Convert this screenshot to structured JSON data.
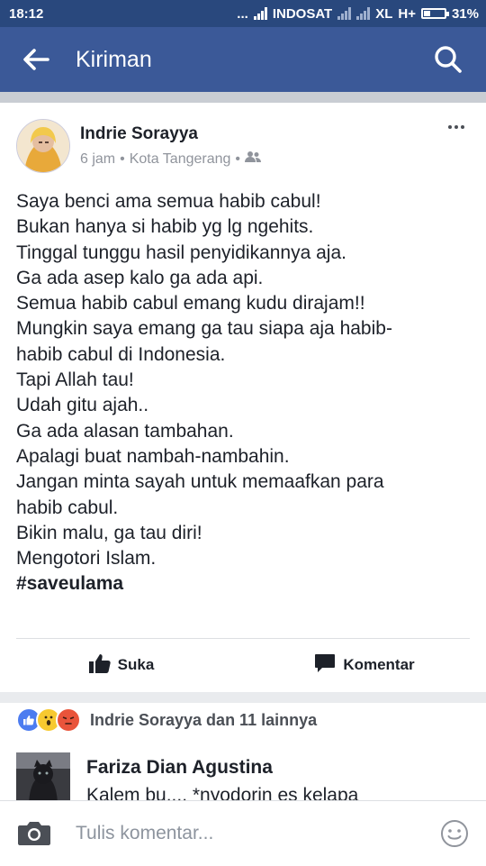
{
  "status_bar": {
    "time": "18:12",
    "dots": "...",
    "carrier1": "INDOSAT",
    "carrier2": "XL",
    "network": "H+",
    "battery_text": "31%",
    "battery_level": 0.31
  },
  "app_bar": {
    "title": "Kiriman",
    "back_icon": "arrow-left-icon",
    "search_icon": "search-icon"
  },
  "post": {
    "author": "Indrie Sorayya",
    "time": "6 jam",
    "sep1": "•",
    "location": "Kota Tangerang",
    "sep2": "•",
    "privacy_icon": "friends-icon",
    "more_icon": "more-dots-icon",
    "lines": [
      "Saya benci ama semua habib cabul!",
      "Bukan hanya si habib yg lg ngehits.",
      "Tinggal tunggu hasil penyidikannya aja.",
      "Ga ada asep kalo ga ada api.",
      "Semua habib cabul emang kudu dirajam!!",
      "Mungkin saya emang ga tau siapa aja habib-",
      "habib cabul di Indonesia.",
      "Tapi Allah tau!",
      "Udah gitu ajah..",
      "Ga ada alasan tambahan.",
      "Apalagi buat nambah-nambahin.",
      "Jangan minta sayah untuk memaafkan para",
      "habib cabul.",
      "Bikin malu, ga tau diri!",
      "Mengotori Islam."
    ],
    "hashtag": "#saveulama",
    "actions": {
      "like_label": "Suka",
      "comment_label": "Komentar"
    }
  },
  "reactions": {
    "icons": [
      "like-reaction-icon",
      "wow-reaction-icon",
      "angry-reaction-icon"
    ],
    "summary": "Indrie Sorayya dan 11 lainnya"
  },
  "comment_preview": {
    "name": "Fariza Dian Agustina",
    "text": "Kalem bu.... *nyodorin es kelapa"
  },
  "composer": {
    "placeholder": "Tulis komentar...",
    "value": ""
  },
  "colors": {
    "appbar": "#3b5998",
    "statusbar": "#29487d",
    "text": "#1d2129",
    "meta": "#90949c"
  }
}
